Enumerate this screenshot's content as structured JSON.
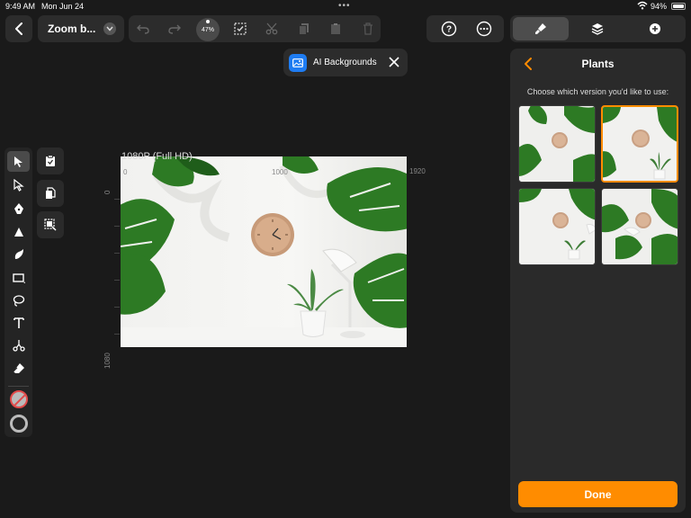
{
  "status_bar": {
    "time": "9:49 AM",
    "date": "Mon Jun 24",
    "more": "•••",
    "battery": "94%"
  },
  "toolbar": {
    "document_title": "Zoom b...",
    "zoom_level": "47%"
  },
  "ai_pill": {
    "label": "AI Backgrounds",
    "accent_color": "#1e7cf2"
  },
  "canvas": {
    "artboard_label": "1080P (Full HD)",
    "ruler_h_labels": [
      "0",
      "1000",
      "1920"
    ],
    "ruler_v_labels": [
      "0",
      "1080"
    ]
  },
  "panel": {
    "title": "Plants",
    "subtitle": "Choose which version you'd like to use:",
    "options": [
      {
        "name": "plants-option-1",
        "selected": false
      },
      {
        "name": "plants-option-2",
        "selected": true
      },
      {
        "name": "plants-option-3",
        "selected": false
      },
      {
        "name": "plants-option-4",
        "selected": false
      }
    ],
    "done_label": "Done",
    "accent_color": "#ff8c00"
  },
  "icons": {
    "left_tools": [
      "pointer-icon",
      "direct-select-icon",
      "pen-icon",
      "anchor-icon",
      "brush-icon",
      "rectangle-icon",
      "lasso-icon",
      "text-icon",
      "scissors-icon",
      "eraser-icon"
    ],
    "sub_tools": [
      "paste-into-icon",
      "copy-style-icon",
      "image-select-icon"
    ]
  }
}
